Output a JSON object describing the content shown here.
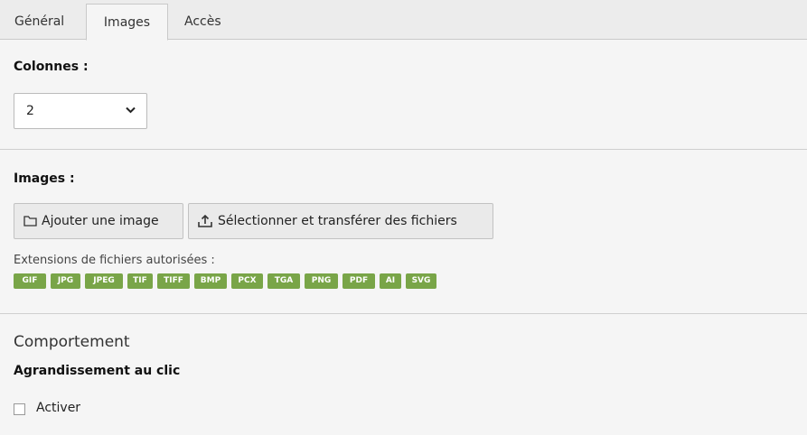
{
  "tabs": [
    {
      "label": "Général",
      "active": false
    },
    {
      "label": "Images",
      "active": true
    },
    {
      "label": "Accès",
      "active": false
    }
  ],
  "columns": {
    "label": "Colonnes :",
    "selected_value": "2"
  },
  "images": {
    "label": "Images :",
    "add_button": "Ajouter une image",
    "upload_button": "Sélectionner et transférer des fichiers",
    "extensions_label": "Extensions de fichiers autorisées :",
    "extensions": [
      "GIF",
      "JPG",
      "JPEG",
      "TIF",
      "TIFF",
      "BMP",
      "PCX",
      "TGA",
      "PNG",
      "PDF",
      "AI",
      "SVG"
    ]
  },
  "behaviour": {
    "title": "Comportement",
    "enlarge_label": "Agrandissement au clic",
    "checkbox_label": "Activer",
    "checked": false
  },
  "colors": {
    "badge": "#79a548",
    "background": "#f5f5f5"
  }
}
